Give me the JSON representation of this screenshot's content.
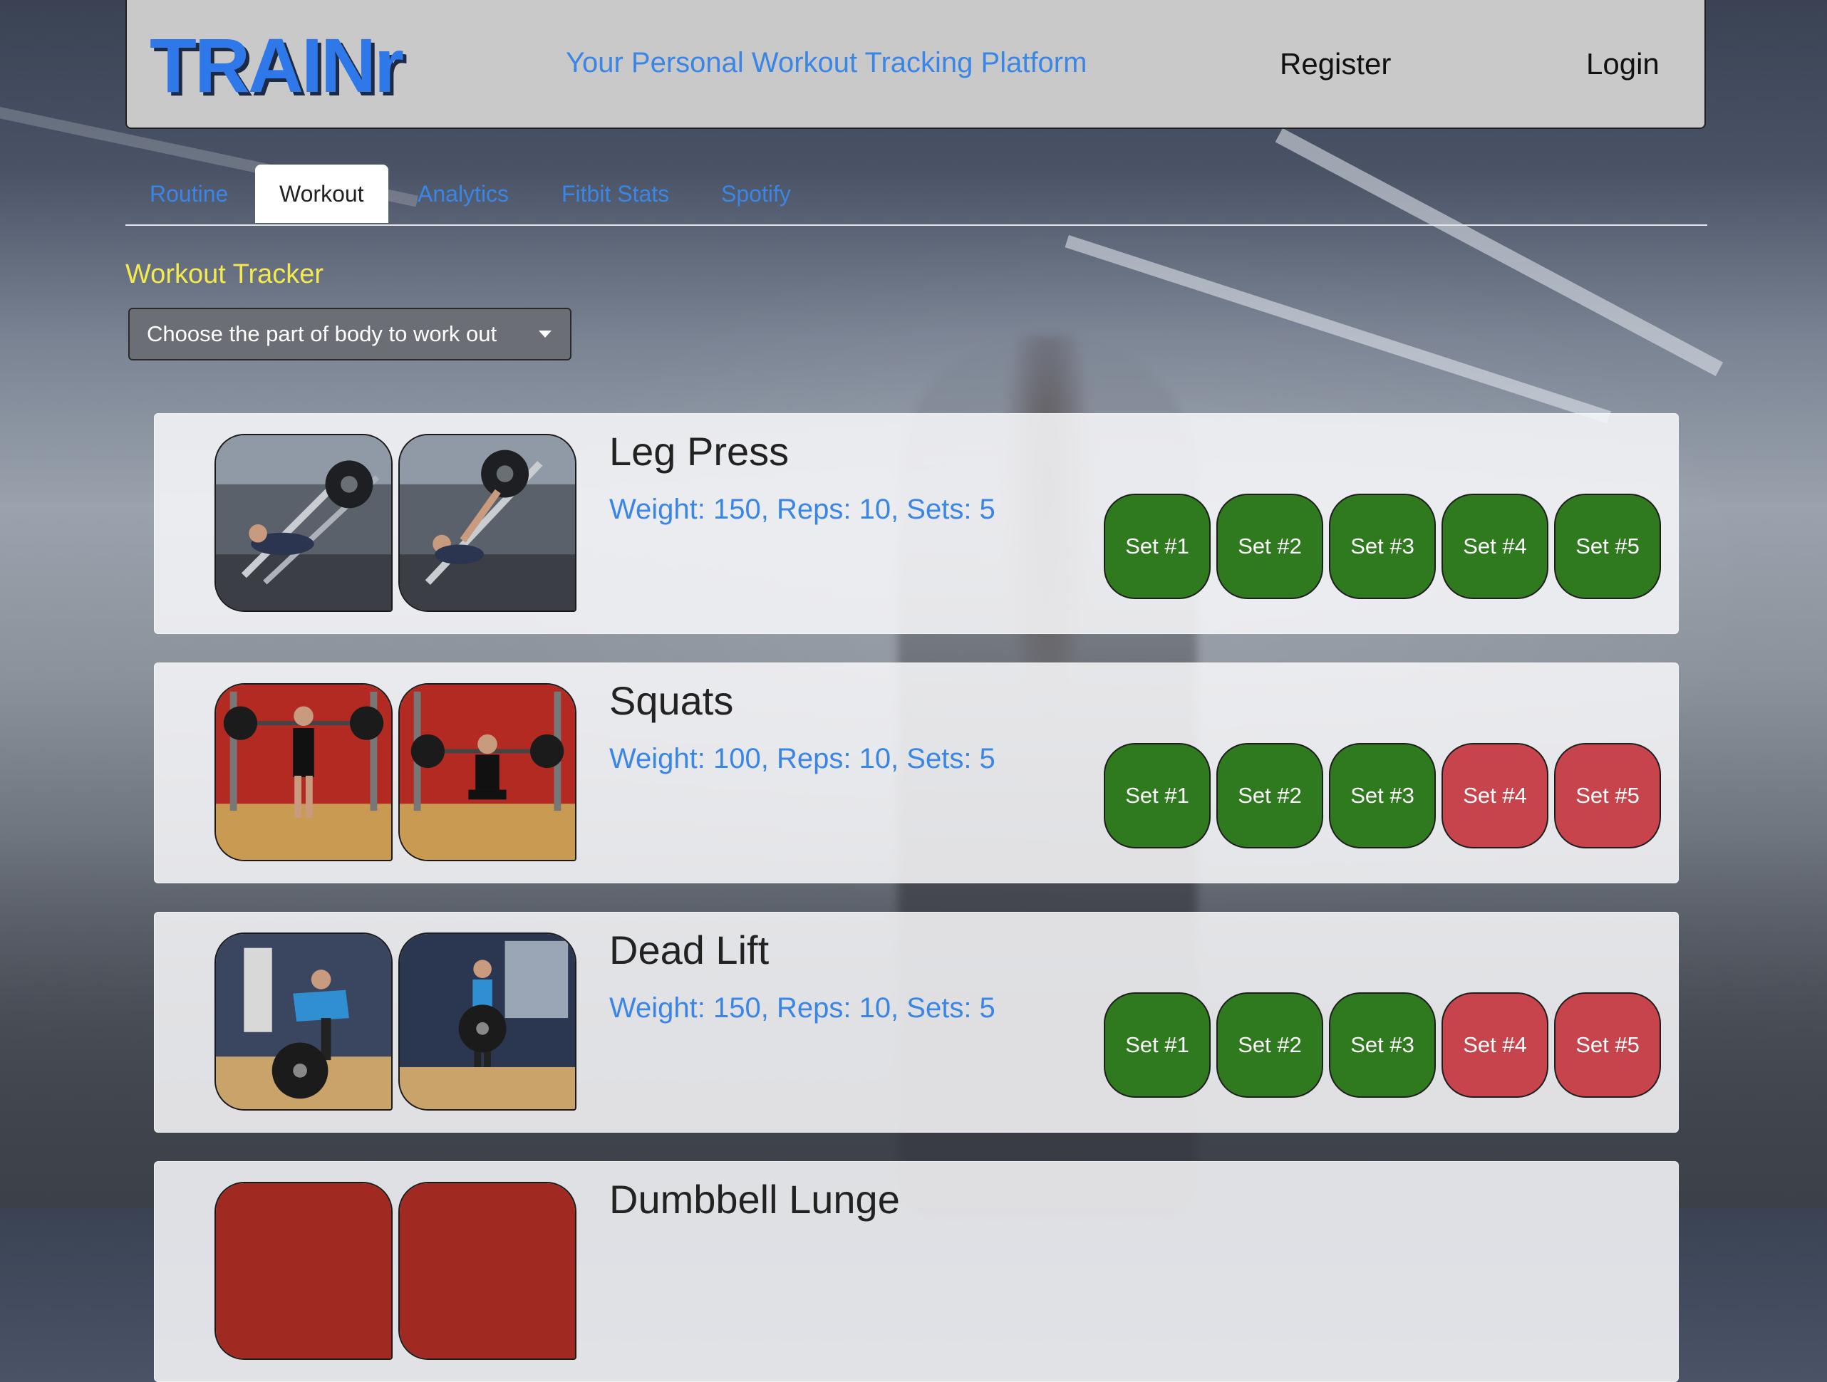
{
  "header": {
    "brand": "TRAINr",
    "tagline": "Your Personal Workout Tracking Platform",
    "register_label": "Register",
    "login_label": "Login"
  },
  "tabs": [
    {
      "label": "Routine",
      "active": false
    },
    {
      "label": "Workout",
      "active": true
    },
    {
      "label": "Analytics",
      "active": false
    },
    {
      "label": "Fitbit Stats",
      "active": false
    },
    {
      "label": "Spotify",
      "active": false
    }
  ],
  "tracker": {
    "title": "Workout Tracker",
    "dropdown_label": "Choose the part of body to work out"
  },
  "exercises": [
    {
      "name": "Leg Press",
      "detail": "Weight: 150, Reps: 10, Sets: 5",
      "sets": [
        {
          "label": "Set #1",
          "status": "done"
        },
        {
          "label": "Set #2",
          "status": "done"
        },
        {
          "label": "Set #3",
          "status": "done"
        },
        {
          "label": "Set #4",
          "status": "done"
        },
        {
          "label": "Set #5",
          "status": "done"
        }
      ]
    },
    {
      "name": "Squats",
      "detail": "Weight: 100, Reps: 10, Sets: 5",
      "sets": [
        {
          "label": "Set #1",
          "status": "done"
        },
        {
          "label": "Set #2",
          "status": "done"
        },
        {
          "label": "Set #3",
          "status": "done"
        },
        {
          "label": "Set #4",
          "status": "todo"
        },
        {
          "label": "Set #5",
          "status": "todo"
        }
      ]
    },
    {
      "name": "Dead Lift",
      "detail": "Weight: 150, Reps: 10, Sets: 5",
      "sets": [
        {
          "label": "Set #1",
          "status": "done"
        },
        {
          "label": "Set #2",
          "status": "done"
        },
        {
          "label": "Set #3",
          "status": "done"
        },
        {
          "label": "Set #4",
          "status": "todo"
        },
        {
          "label": "Set #5",
          "status": "todo"
        }
      ]
    },
    {
      "name": "Dumbbell Lunge",
      "detail": "",
      "sets": []
    }
  ],
  "colors": {
    "brand": "#2f78ea",
    "link": "#3a86e6",
    "tracker_title": "#f5ea4d",
    "set_done": "#2f7a1f",
    "set_todo": "#c8444c"
  }
}
